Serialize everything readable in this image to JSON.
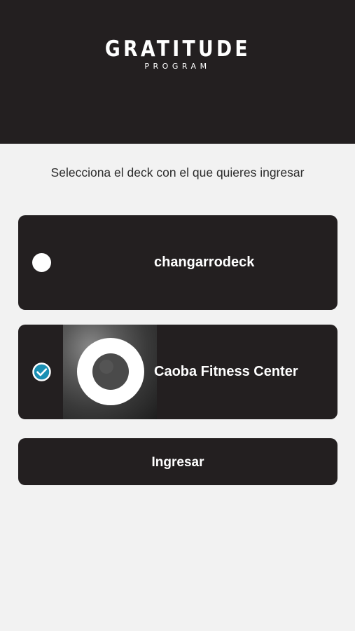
{
  "header": {
    "logo_main": "GRATITUDE",
    "logo_sub": "PROGRAM"
  },
  "prompt": "Selecciona el deck con el que quieres ingresar",
  "decks": [
    {
      "name": "changarrodeck",
      "selected": false,
      "icon": "radio-empty-icon"
    },
    {
      "name": "Caoba Fitness Center",
      "selected": true,
      "icon": "check-circle-icon"
    }
  ],
  "submit_label": "Ingresar",
  "colors": {
    "background": "#f2f2f2",
    "dark": "#231f20",
    "accent": "#1a8fb3",
    "text": "#2b2b2b"
  }
}
